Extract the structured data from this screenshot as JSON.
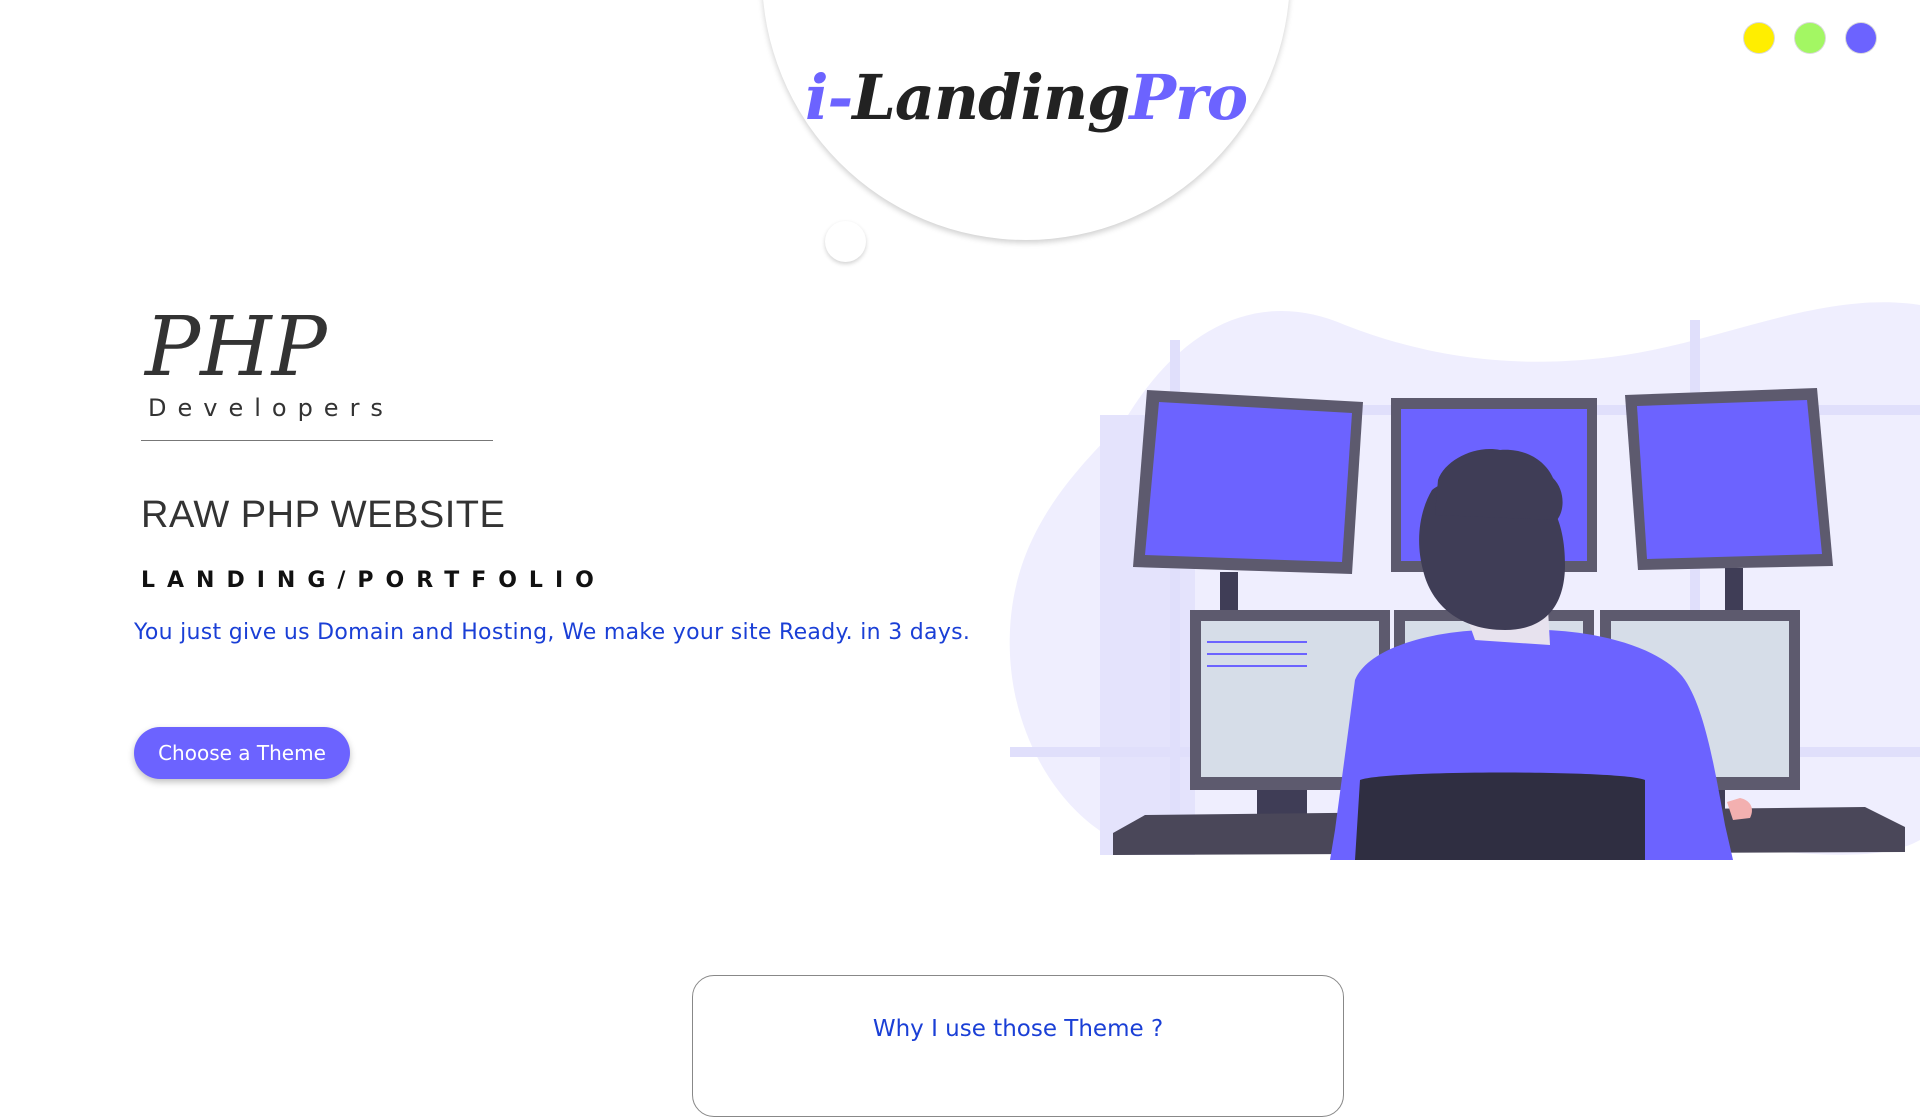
{
  "logo": {
    "prefix": "i-",
    "main": "Landing",
    "suffix": "Pro"
  },
  "theme_switcher": {
    "dots": [
      {
        "name": "yellow",
        "color": "#ffee00"
      },
      {
        "name": "green",
        "color": "#a3f763"
      },
      {
        "name": "purple",
        "color": "#6c63ff"
      }
    ]
  },
  "hero": {
    "brand_title": "PHP",
    "brand_sub": "Developers",
    "headline": "RAW PHP WEBSITE",
    "subheadline": "LANDING/PORTFOLIO",
    "tagline": "You just give us Domain and Hosting, We make your site Ready. in 3 days.",
    "cta_label": "Choose a Theme"
  },
  "illustration": {
    "name": "developer-at-monitors-illustration",
    "accent": "#6c63ff"
  },
  "info_card": {
    "title": "Why I use those Theme ?"
  },
  "colors": {
    "accent": "#6c63ff",
    "link_blue": "#1a3fd6",
    "text_dark": "#333333"
  }
}
